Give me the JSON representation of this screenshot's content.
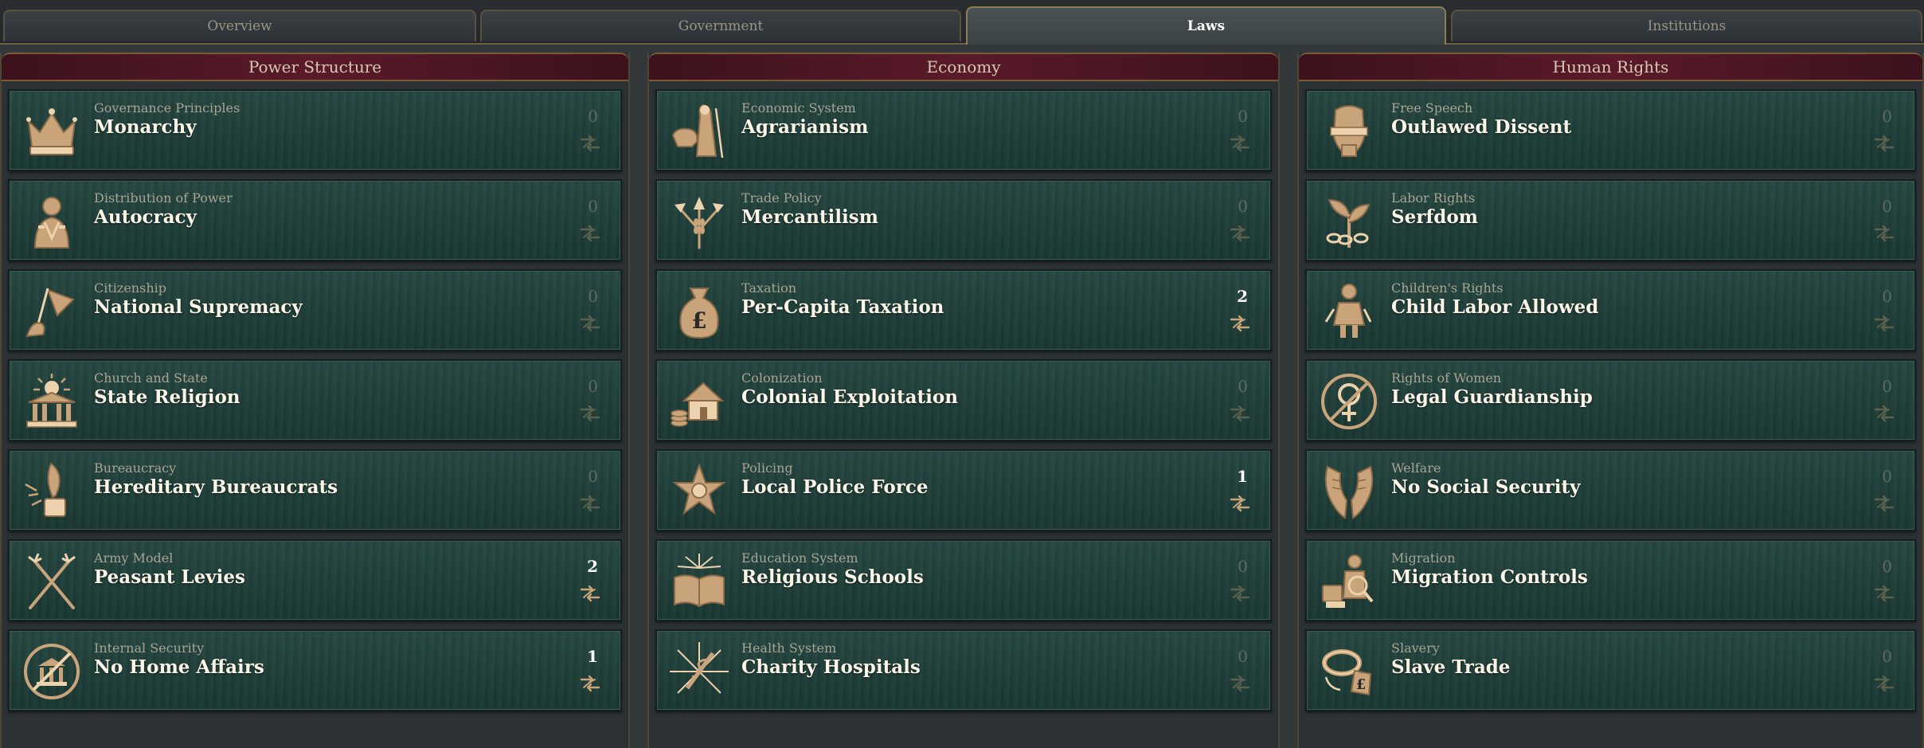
{
  "tabs": [
    {
      "label": "Overview",
      "active": false
    },
    {
      "label": "Government",
      "active": false
    },
    {
      "label": "Laws",
      "active": true
    },
    {
      "label": "Institutions",
      "active": false
    }
  ],
  "colors": {
    "header_red": "#5a1a2a",
    "card_green": "#1f3f39",
    "gold_icon": "#c9a47a"
  },
  "columns": [
    {
      "title": "Power Structure",
      "laws": [
        {
          "group": "Governance Principles",
          "name": "Monarchy",
          "count": "0",
          "icon": "crown-icon"
        },
        {
          "group": "Distribution of Power",
          "name": "Autocracy",
          "count": "0",
          "icon": "autocrat-bust-icon"
        },
        {
          "group": "Citizenship",
          "name": "National Supremacy",
          "count": "0",
          "icon": "flag-hand-icon"
        },
        {
          "group": "Church and State",
          "name": "State Religion",
          "count": "0",
          "icon": "temple-sun-icon"
        },
        {
          "group": "Bureaucracy",
          "name": "Hereditary Bureaucrats",
          "count": "0",
          "icon": "quill-inkwell-icon"
        },
        {
          "group": "Army Model",
          "name": "Peasant Levies",
          "count": "2",
          "icon": "crossed-pitchforks-icon"
        },
        {
          "group": "Internal Security",
          "name": "No Home Affairs",
          "count": "1",
          "icon": "crossed-building-icon"
        }
      ]
    },
    {
      "title": "Economy",
      "laws": [
        {
          "group": "Economic System",
          "name": "Agrarianism",
          "count": "0",
          "icon": "farmer-cow-icon"
        },
        {
          "group": "Trade Policy",
          "name": "Mercantilism",
          "count": "0",
          "icon": "wheat-arrows-icon"
        },
        {
          "group": "Taxation",
          "name": "Per-Capita Taxation",
          "count": "2",
          "icon": "money-bag-icon"
        },
        {
          "group": "Colonization",
          "name": "Colonial Exploitation",
          "count": "0",
          "icon": "house-coins-icon"
        },
        {
          "group": "Policing",
          "name": "Local Police Force",
          "count": "1",
          "icon": "sheriff-star-icon"
        },
        {
          "group": "Education System",
          "name": "Religious Schools",
          "count": "0",
          "icon": "open-book-icon"
        },
        {
          "group": "Health System",
          "name": "Charity Hospitals",
          "count": "0",
          "icon": "caduceus-burst-icon"
        }
      ]
    },
    {
      "title": "Human Rights",
      "laws": [
        {
          "group": "Free Speech",
          "name": "Outlawed Dissent",
          "count": "0",
          "icon": "gagged-head-icon"
        },
        {
          "group": "Labor Rights",
          "name": "Serfdom",
          "count": "0",
          "icon": "plant-chain-icon"
        },
        {
          "group": "Children's Rights",
          "name": "Child Labor Allowed",
          "count": "0",
          "icon": "child-worker-icon"
        },
        {
          "group": "Rights of Women",
          "name": "Legal Guardianship",
          "count": "0",
          "icon": "crossed-venus-icon"
        },
        {
          "group": "Welfare",
          "name": "No Social Security",
          "count": "0",
          "icon": "empty-hands-icon"
        },
        {
          "group": "Migration",
          "name": "Migration Controls",
          "count": "0",
          "icon": "migrant-magnifier-icon"
        },
        {
          "group": "Slavery",
          "name": "Slave Trade",
          "count": "0",
          "icon": "shackle-tag-icon"
        }
      ]
    }
  ]
}
